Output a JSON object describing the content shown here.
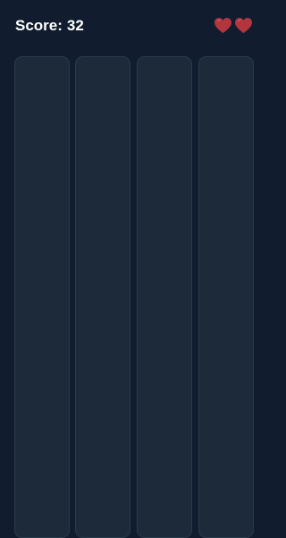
{
  "hud": {
    "score_label": "Score:",
    "score_value": "32",
    "lives": 2,
    "heart_color": "#b3363f"
  },
  "board": {
    "lanes": 4,
    "lane_color": "#1d2a3a",
    "background_color": "#111d2e"
  },
  "icons": {
    "life": "heart-icon"
  }
}
